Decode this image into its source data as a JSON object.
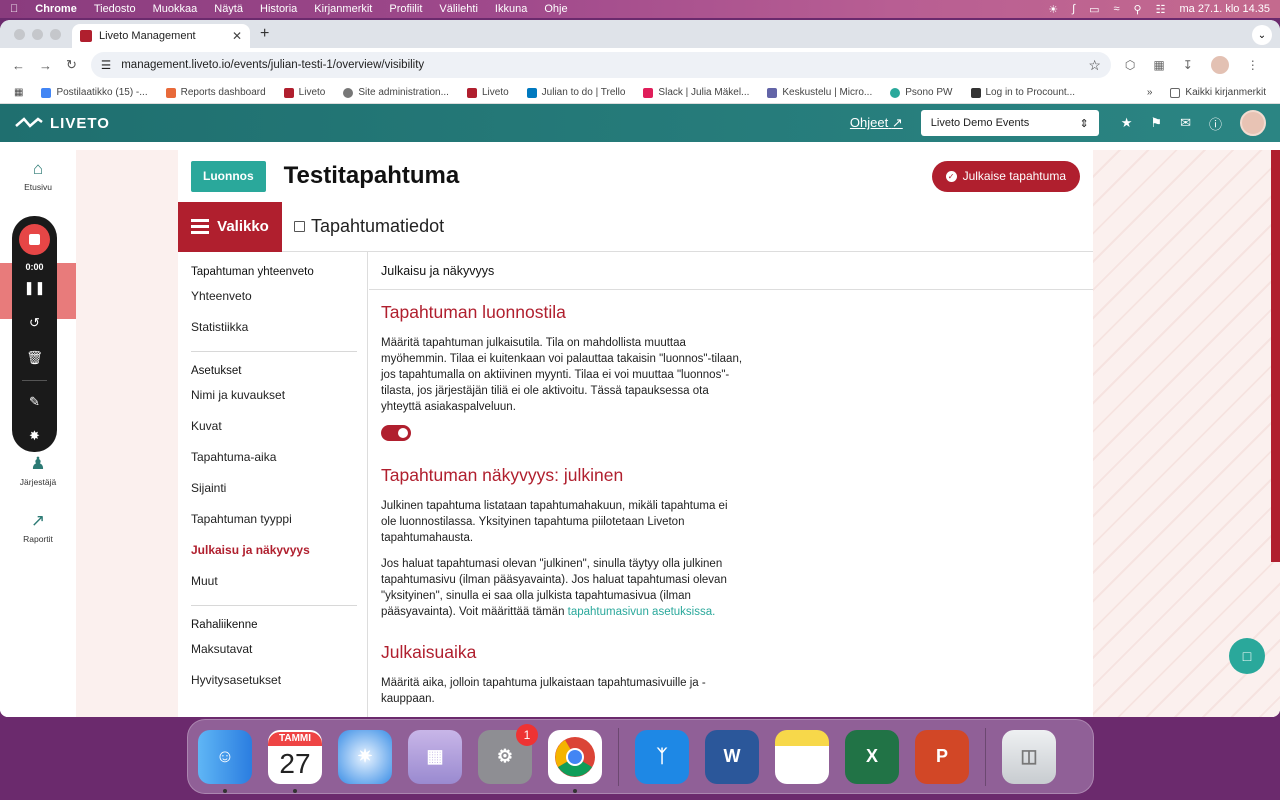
{
  "menubar": {
    "apple": "",
    "items": [
      "Chrome",
      "Tiedosto",
      "Muokkaa",
      "Näytä",
      "Historia",
      "Kirjanmerkit",
      "Profiilit",
      "Välilehti",
      "Ikkuna",
      "Ohje"
    ],
    "clock": "ma 27.1. klo 14.35"
  },
  "browser": {
    "tab_title": "Liveto Management",
    "url": "management.liveto.io/events/julian-testi-1/overview/visibility",
    "bookmarks": [
      "Postilaatikko (15) -...",
      "Reports dashboard",
      "Liveto",
      "Site administration...",
      "Liveto",
      "Julian to do | Trello",
      "Slack | Julia Mäkel...",
      "Keskustelu | Micro...",
      "Psono PW",
      "Log in to Procount..."
    ],
    "all_bookmarks": "Kaikki kirjanmerkit"
  },
  "app": {
    "logo": "LIVETO",
    "help": "Ohjeet",
    "org": "Liveto Demo Events",
    "nav": [
      {
        "label": "Etusivu",
        "icon": "home-icon"
      },
      {
        "label": "Järjestäjä",
        "icon": "users-icon"
      },
      {
        "label": "Raportit",
        "icon": "chart-icon"
      }
    ]
  },
  "recorder": {
    "time": "0:00"
  },
  "event": {
    "status": "Luonnos",
    "title": "Testitapahtuma",
    "publish": "Julkaise tapahtuma",
    "menu": "Valikko",
    "breadcrumb": "Tapahtumatiedot"
  },
  "sidebar": {
    "groups": [
      {
        "title": "Tapahtuman yhteenveto",
        "items": [
          "Yhteenveto",
          "Statistiikka"
        ]
      },
      {
        "title": "Asetukset",
        "items": [
          "Nimi ja kuvaukset",
          "Kuvat",
          "Tapahtuma-aika",
          "Sijainti",
          "Tapahtuman tyyppi",
          "Julkaisu ja näkyvyys",
          "Muut"
        ]
      },
      {
        "title": "Rahaliikenne",
        "items": [
          "Maksutavat",
          "Hyvitysasetukset"
        ]
      }
    ],
    "active": "Julkaisu ja näkyvyys"
  },
  "main": {
    "section": "Julkaisu ja näkyvyys",
    "draft_title": "Tapahtuman luonnostila",
    "draft_text": "Määritä tapahtuman julkaisutila. Tila on mahdollista muuttaa myöhemmin. Tilaa ei kuitenkaan voi palauttaa takaisin \"luonnos\"-tilaan, jos tapahtumalla on aktiivinen myynti. Tilaa ei voi muuttaa \"luonnos\"-tilasta, jos järjestäjän tiliä ei ole aktivoitu. Tässä tapauksessa ota yhteyttä asiakaspalveluun.",
    "draft_toggle_on": true,
    "visibility_title": "Tapahtuman näkyvyys: julkinen",
    "visibility_text1": "Julkinen tapahtuma listataan tapahtumahakuun, mikäli tapahtuma ei ole luonnostilassa. Yksityinen tapahtuma piilotetaan Liveton tapahtumahausta.",
    "visibility_text2": "Jos haluat tapahtumasi olevan \"julkinen\", sinulla täytyy olla julkinen tapahtumasivu (ilman pääsyavainta). Jos haluat tapahtumasi olevan \"yksityinen\", sinulla ei saa olla julkista tapahtumasivua (ilman pääsyavainta). Voit määrittää tämän ",
    "visibility_link": "tapahtumasivun asetuksissa.",
    "pubtime_title": "Julkaisuaika",
    "pubtime_text": "Määritä aika, jolloin tapahtuma julkaistaan tapahtumasivuille ja -kauppaan."
  },
  "dock": {
    "calendar_month": "TAMMI",
    "calendar_day": "27",
    "settings_badge": "1",
    "apps": [
      "Finder",
      "Calendar",
      "Safari",
      "Launchpad",
      "System Settings",
      "Chrome",
      "Bluetooth",
      "Word",
      "Notes",
      "Excel",
      "PowerPoint",
      "Trash"
    ]
  }
}
